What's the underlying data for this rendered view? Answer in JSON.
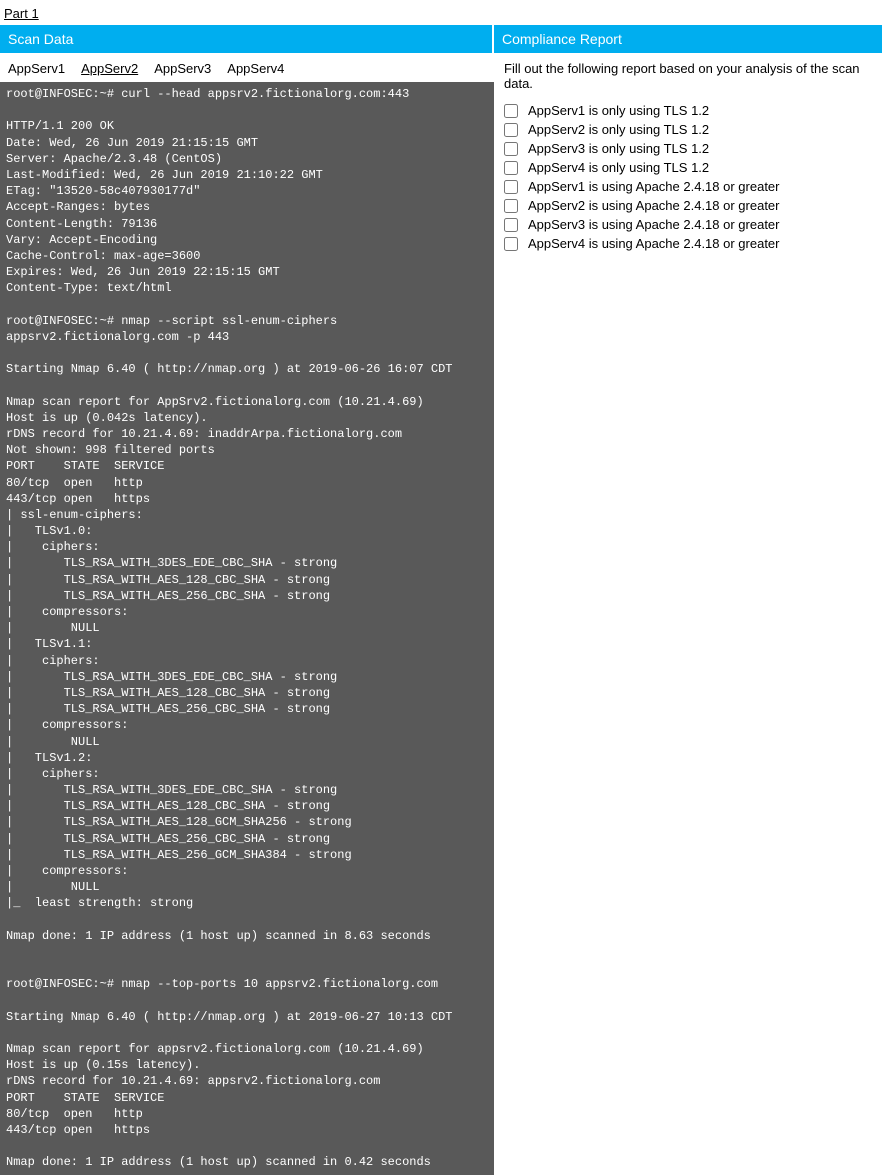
{
  "part_label": "Part 1",
  "left": {
    "title": "Scan Data",
    "tabs": [
      "AppServ1",
      "AppServ2",
      "AppServ3",
      "AppServ4"
    ],
    "active_tab_index": 1,
    "terminal": "root@INFOSEC:~# curl --head appsrv2.fictionalorg.com:443\n\nHTTP/1.1 200 OK\nDate: Wed, 26 Jun 2019 21:15:15 GMT\nServer: Apache/2.3.48 (CentOS)\nLast-Modified: Wed, 26 Jun 2019 21:10:22 GMT\nETag: \"13520-58c407930177d\"\nAccept-Ranges: bytes\nContent-Length: 79136\nVary: Accept-Encoding\nCache-Control: max-age=3600\nExpires: Wed, 26 Jun 2019 22:15:15 GMT\nContent-Type: text/html\n\nroot@INFOSEC:~# nmap --script ssl-enum-ciphers\nappsrv2.fictionalorg.com -p 443\n\nStarting Nmap 6.40 ( http://nmap.org ) at 2019-06-26 16:07 CDT\n\nNmap scan report for AppSrv2.fictionalorg.com (10.21.4.69)\nHost is up (0.042s latency).\nrDNS record for 10.21.4.69: inaddrArpa.fictionalorg.com\nNot shown: 998 filtered ports\nPORT    STATE  SERVICE\n80/tcp  open   http\n443/tcp open   https\n| ssl-enum-ciphers:\n|   TLSv1.0:\n|    ciphers:\n|       TLS_RSA_WITH_3DES_EDE_CBC_SHA - strong\n|       TLS_RSA_WITH_AES_128_CBC_SHA - strong\n|       TLS_RSA_WITH_AES_256_CBC_SHA - strong\n|    compressors:\n|        NULL\n|   TLSv1.1:\n|    ciphers:\n|       TLS_RSA_WITH_3DES_EDE_CBC_SHA - strong\n|       TLS_RSA_WITH_AES_128_CBC_SHA - strong\n|       TLS_RSA_WITH_AES_256_CBC_SHA - strong\n|    compressors:\n|        NULL\n|   TLSv1.2:\n|    ciphers:\n|       TLS_RSA_WITH_3DES_EDE_CBC_SHA - strong\n|       TLS_RSA_WITH_AES_128_CBC_SHA - strong\n|       TLS_RSA_WITH_AES_128_GCM_SHA256 - strong\n|       TLS_RSA_WITH_AES_256_CBC_SHA - strong\n|       TLS_RSA_WITH_AES_256_GCM_SHA384 - strong\n|    compressors:\n|        NULL\n|_  least strength: strong\n\nNmap done: 1 IP address (1 host up) scanned in 8.63 seconds\n\n\nroot@INFOSEC:~# nmap --top-ports 10 appsrv2.fictionalorg.com\n\nStarting Nmap 6.40 ( http://nmap.org ) at 2019-06-27 10:13 CDT\n\nNmap scan report for appsrv2.fictionalorg.com (10.21.4.69)\nHost is up (0.15s latency).\nrDNS record for 10.21.4.69: appsrv2.fictionalorg.com\nPORT    STATE  SERVICE\n80/tcp  open   http\n443/tcp open   https\n\nNmap done: 1 IP address (1 host up) scanned in 0.42 seconds"
  },
  "right": {
    "title": "Compliance Report",
    "description": "Fill out the following report based on your analysis of the scan data.",
    "items": [
      "AppServ1 is only using TLS 1.2",
      "AppServ2 is only using TLS 1.2",
      "AppServ3 is only using TLS 1.2",
      "AppServ4 is only using TLS 1.2",
      "AppServ1 is using Apache 2.4.18 or greater",
      "AppServ2 is using Apache 2.4.18 or greater",
      "AppServ3 is using Apache 2.4.18 or greater",
      "AppServ4 is using Apache 2.4.18 or greater"
    ]
  }
}
